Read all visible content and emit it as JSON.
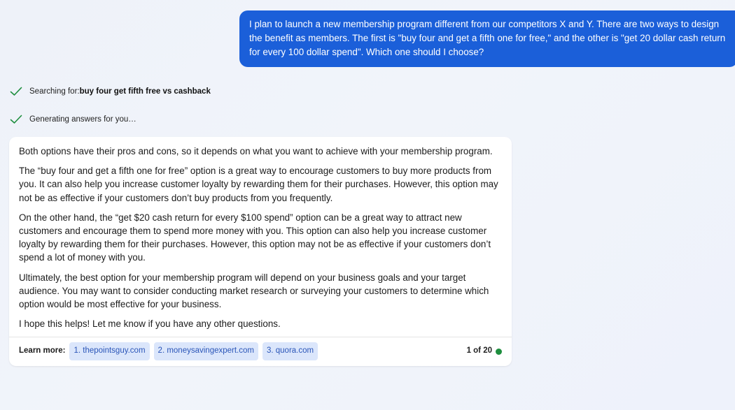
{
  "user_message": "I plan to launch a new membership program different from our competitors X and Y. There are two ways to design the benefit as members. The first is \"buy four and get a fifth one for free,\" and the other is \"get 20 dollar cash return for every 100 dollar spend\". Which one should I choose?",
  "status": {
    "searching_prefix": "Searching for: ",
    "searching_query": "buy four get fifth free vs cashback",
    "generating": "Generating answers for you…"
  },
  "answer": {
    "paragraphs": [
      "Both options have their pros and cons, so it depends on what you want to achieve with your membership program.",
      "The “buy four and get a fifth one for free” option is a great way to encourage customers to buy more products from you. It can also help you increase customer loyalty by rewarding them for their purchases. However, this option may not be as effective if your customers don’t buy products from you frequently.",
      "On the other hand, the “get $20 cash return for every $100 spend” option can be a great way to attract new customers and encourage them to spend more money with you. This option can also help you increase customer loyalty by rewarding them for their purchases. However, this option may not be as effective if your customers don’t spend a lot of money with you.",
      "Ultimately, the best option for your membership program will depend on your business goals and your target audience. You may want to consider conducting market research or surveying your customers to determine which option would be most effective for your business.",
      "I hope this helps! Let me know if you have any other questions."
    ]
  },
  "learn_more": {
    "label": "Learn more:",
    "links": [
      "1. thepointsguy.com",
      "2. moneysavingexpert.com",
      "3. quora.com"
    ],
    "counter": "1 of 20"
  },
  "colors": {
    "user_bubble": "#1b5fd9",
    "check": "#1e8e3e",
    "chip_bg": "#dbe6fb",
    "chip_text": "#2a55b8"
  }
}
